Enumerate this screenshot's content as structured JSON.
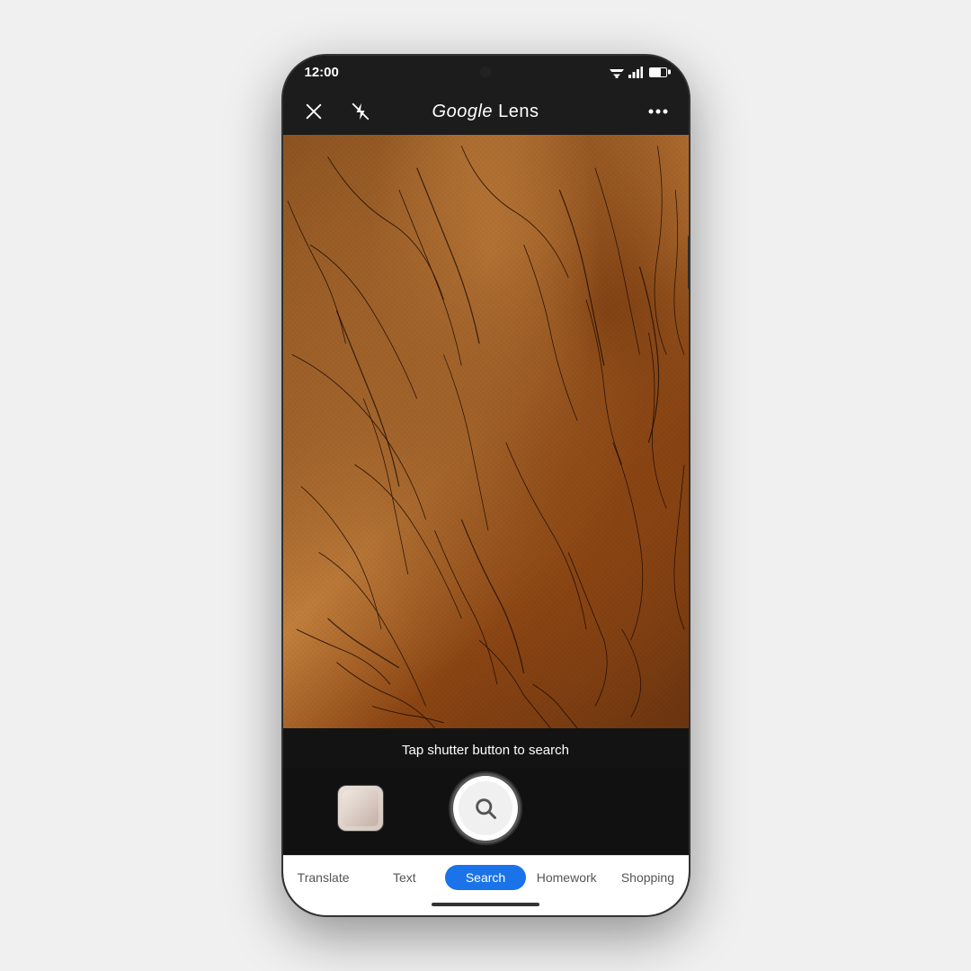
{
  "status_bar": {
    "time": "12:00",
    "wifi": "▼",
    "signal": "signal",
    "battery": "battery"
  },
  "top_bar": {
    "title_google": "Google",
    "title_lens": " Lens",
    "close_label": "close",
    "flash_label": "flash off",
    "more_label": "more options"
  },
  "camera": {
    "hint_text": "Tap shutter button to search"
  },
  "tabs": [
    {
      "label": "Translate",
      "active": false
    },
    {
      "label": "Text",
      "active": false
    },
    {
      "label": "Search",
      "active": true
    },
    {
      "label": "Homework",
      "active": false
    },
    {
      "label": "Shopping",
      "active": false
    }
  ]
}
